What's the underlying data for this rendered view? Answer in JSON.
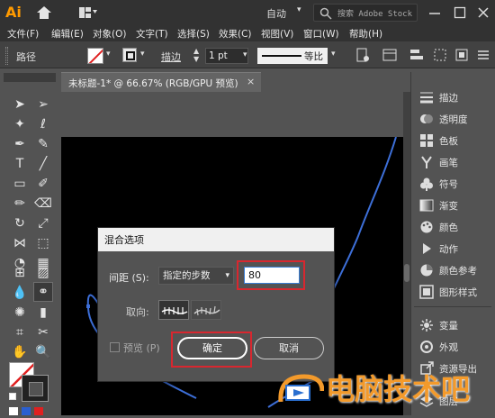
{
  "app": {
    "logo_text": "Ai",
    "workspace_label": "自动",
    "search_placeholder": "搜索 Adobe Stock"
  },
  "menu": {
    "items": [
      "文件(F)",
      "编辑(E)",
      "对象(O)",
      "文字(T)",
      "选择(S)",
      "效果(C)",
      "视图(V)",
      "窗口(W)",
      "帮助(H)"
    ]
  },
  "control_bar": {
    "selection_label": "路径",
    "stroke_label": "描边",
    "stroke_value": "1 pt",
    "profile_label": "等比"
  },
  "document": {
    "tab_title": "未标题-1* @ 66.67% (RGB/GPU 预览)",
    "close_glyph": "×"
  },
  "right_panel": {
    "items": [
      {
        "label": "描边",
        "icon": "stroke-lines-icon"
      },
      {
        "label": "透明度",
        "icon": "transparency-icon"
      },
      {
        "label": "色板",
        "icon": "swatches-grid-icon"
      },
      {
        "label": "画笔",
        "icon": "brush-icon"
      },
      {
        "label": "符号",
        "icon": "club-symbol-icon"
      },
      {
        "label": "渐变",
        "icon": "gradient-icon"
      },
      {
        "label": "颜色",
        "icon": "color-palette-icon"
      },
      {
        "label": "动作",
        "icon": "play-icon"
      },
      {
        "label": "颜色参考",
        "icon": "color-guide-icon"
      },
      {
        "label": "图形样式",
        "icon": "graphic-styles-icon"
      },
      {
        "label": "变量",
        "icon": "variables-icon"
      },
      {
        "label": "外观",
        "icon": "appearance-icon"
      },
      {
        "label": "资源导出",
        "icon": "asset-export-icon"
      },
      {
        "label": "图层",
        "icon": "layers-icon"
      }
    ]
  },
  "dialog": {
    "title": "混合选项",
    "spacing_label": "间距 (S):",
    "spacing_option": "指定的步数",
    "steps_value": "80",
    "orientation_label": "取向:",
    "preview_label": "预览 (P)",
    "ok_label": "确定",
    "cancel_label": "取消"
  },
  "watermark": {
    "text": "电脑技术吧"
  },
  "colors": {
    "accent_highlight": "#d8272f",
    "ai_logo": "#ff9a00",
    "curve": "#3d6fd8",
    "watermark": "#f39a2b"
  }
}
